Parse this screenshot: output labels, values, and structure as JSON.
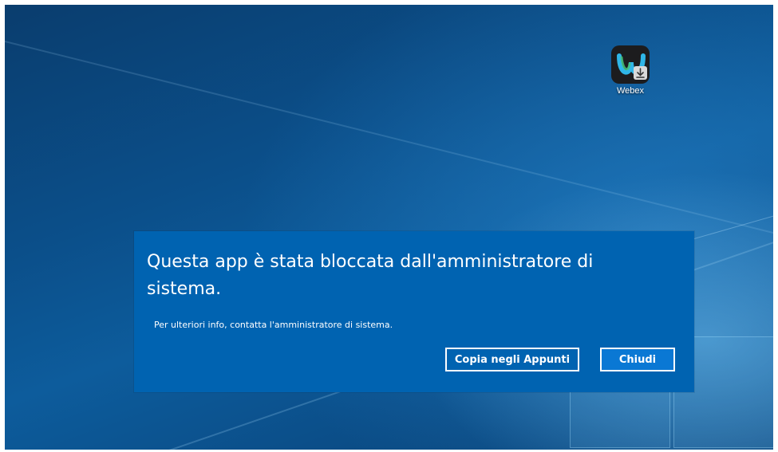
{
  "desktop": {
    "icons": [
      {
        "label": "Webex",
        "icon": "webex-app-icon"
      }
    ]
  },
  "dialog": {
    "title": "Questa app è stata bloccata dall'amministratore di sistema.",
    "message": "Per ulteriori info, contatta l'amministratore di sistema.",
    "buttons": {
      "copy_label": "Copia negli Appunti",
      "close_label": "Chiudi"
    }
  },
  "colors": {
    "dialog_background": "#0063b1",
    "primary_button": "#0a78d4",
    "text": "#ffffff"
  }
}
